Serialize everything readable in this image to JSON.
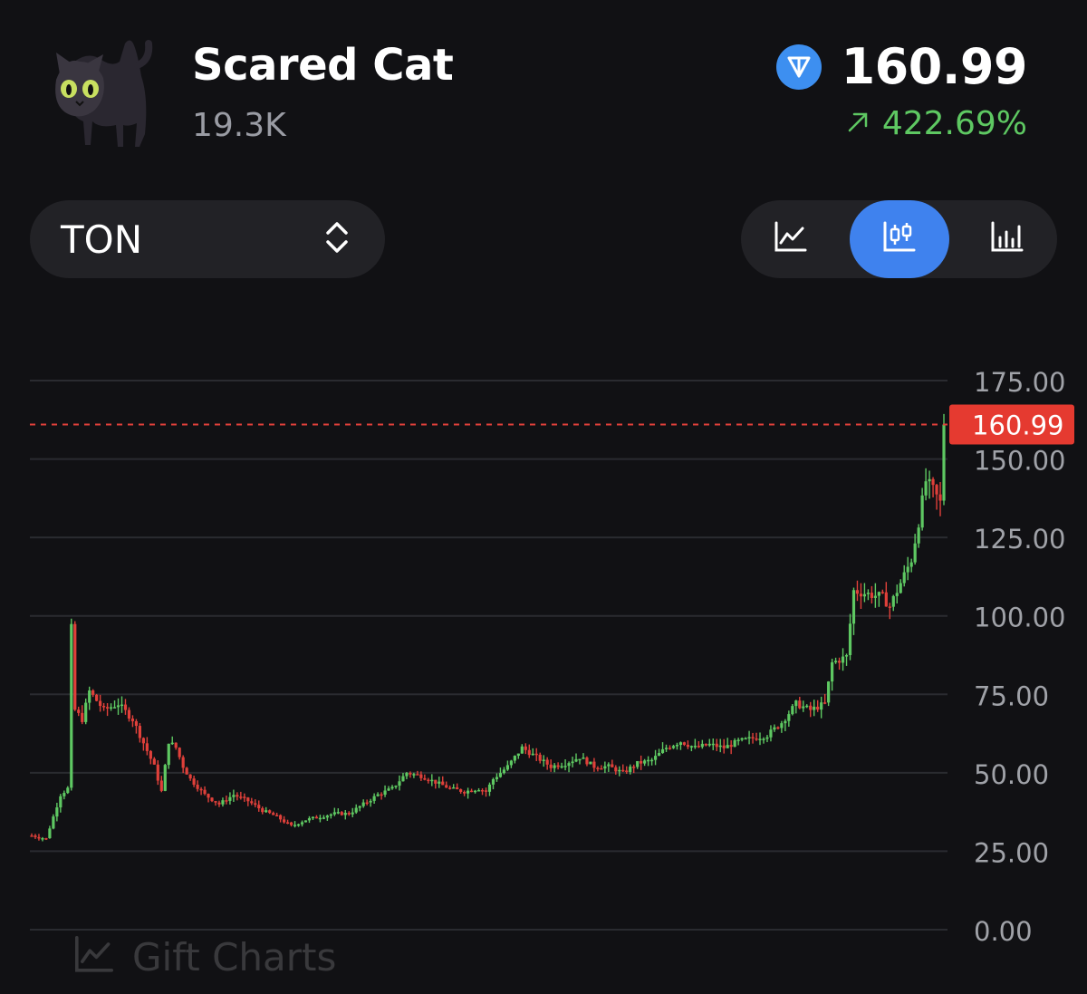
{
  "gift": {
    "name": "Scared Cat",
    "supply": "19.3K",
    "avatar_icon": "scared-cat-icon",
    "price": "160.99",
    "currency_icon": "ton-diamond-icon",
    "change": "422.69%",
    "change_icon": "arrow-up-right-icon",
    "change_color": "#5ec862"
  },
  "controls": {
    "currency": "TON",
    "currency_icon": "chevron-updown-icon",
    "chart_types": [
      {
        "name": "line",
        "icon": "line-chart-icon",
        "active": false
      },
      {
        "name": "candlestick",
        "icon": "candlestick-icon",
        "active": true
      },
      {
        "name": "bar",
        "icon": "bar-chart-icon",
        "active": false
      }
    ],
    "active_color": "#3f82ee"
  },
  "watermark": {
    "text": "Gift Charts",
    "icon": "line-chart-icon"
  },
  "chart_data": {
    "type": "candlestick",
    "ylim": [
      0,
      175
    ],
    "yticks": [
      "0.00",
      "25.00",
      "50.00",
      "75.00",
      "100.00",
      "125.00",
      "150.00",
      "175.00"
    ],
    "last_price": 160.99,
    "last_price_label": "160.99",
    "up_color": "#5ec862",
    "down_color": "#e0403a",
    "grid": true,
    "price_path": [
      [
        0,
        30
      ],
      [
        4,
        29
      ],
      [
        8,
        43
      ],
      [
        10,
        45
      ],
      [
        11,
        96
      ],
      [
        12,
        70
      ],
      [
        14,
        67
      ],
      [
        16,
        76
      ],
      [
        20,
        70
      ],
      [
        24,
        72
      ],
      [
        28,
        67
      ],
      [
        32,
        57
      ],
      [
        34,
        52
      ],
      [
        36,
        44
      ],
      [
        38,
        60
      ],
      [
        40,
        58
      ],
      [
        42,
        52
      ],
      [
        44,
        48
      ],
      [
        48,
        43
      ],
      [
        52,
        40
      ],
      [
        56,
        43
      ],
      [
        60,
        41
      ],
      [
        64,
        38
      ],
      [
        68,
        36
      ],
      [
        72,
        33
      ],
      [
        76,
        35
      ],
      [
        80,
        36
      ],
      [
        84,
        37
      ],
      [
        88,
        37
      ],
      [
        92,
        40
      ],
      [
        96,
        43
      ],
      [
        100,
        45
      ],
      [
        104,
        50
      ],
      [
        108,
        49
      ],
      [
        112,
        47
      ],
      [
        116,
        45
      ],
      [
        120,
        44
      ],
      [
        124,
        45
      ],
      [
        126,
        44
      ],
      [
        128,
        48
      ],
      [
        132,
        52
      ],
      [
        136,
        58
      ],
      [
        140,
        55
      ],
      [
        144,
        52
      ],
      [
        148,
        53
      ],
      [
        152,
        55
      ],
      [
        156,
        52
      ],
      [
        160,
        52
      ],
      [
        164,
        50
      ],
      [
        168,
        53
      ],
      [
        172,
        54
      ],
      [
        176,
        58
      ],
      [
        180,
        60
      ],
      [
        184,
        58
      ],
      [
        188,
        59
      ],
      [
        192,
        58
      ],
      [
        196,
        60
      ],
      [
        200,
        61
      ],
      [
        204,
        62
      ],
      [
        208,
        66
      ],
      [
        212,
        72
      ],
      [
        216,
        70
      ],
      [
        220,
        72
      ],
      [
        222,
        85
      ],
      [
        226,
        87
      ],
      [
        228,
        108
      ],
      [
        232,
        107
      ],
      [
        236,
        106
      ],
      [
        238,
        103
      ],
      [
        240,
        108
      ],
      [
        244,
        118
      ],
      [
        246,
        130
      ],
      [
        248,
        143
      ],
      [
        250,
        140
      ],
      [
        252,
        136
      ],
      [
        253,
        161
      ]
    ]
  }
}
